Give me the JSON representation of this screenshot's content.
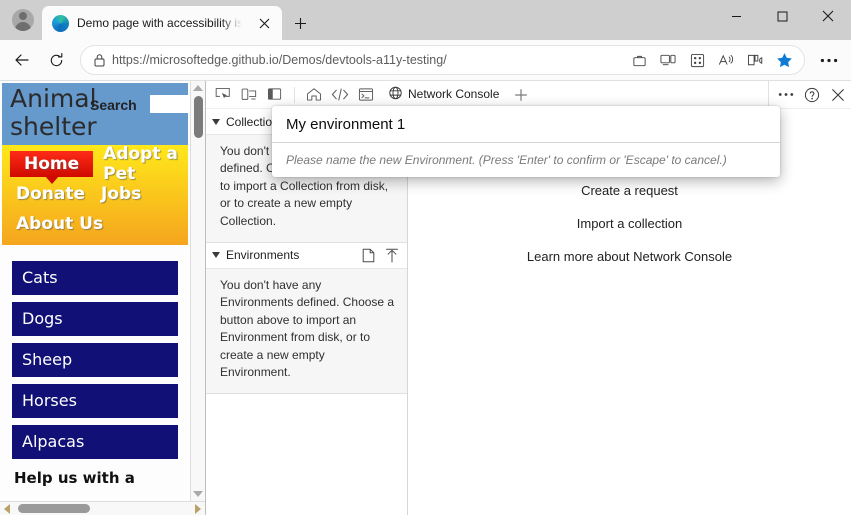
{
  "browser": {
    "tab": {
      "title": "Demo page with accessibility issues",
      "favicon": "edge-logo"
    },
    "new_tab_label": "+",
    "window_controls": {
      "minimize": "—",
      "maximize": "☐",
      "close": "✕"
    },
    "address": {
      "scheme_host": "https://microsoftedge.github.io",
      "path": "/Demos/devtools-a11y-testing/",
      "full_url": "https://microsoftedge.github.io/Demos/devtools-a11y-testing/",
      "lock_icon": "lock-icon"
    },
    "toolbar_icons": [
      "collections-icon",
      "split-screen-icon",
      "browser-essentials-icon",
      "read-aloud-icon",
      "immersive-reader-icon",
      "favorite-star-icon",
      "settings-more-icon"
    ],
    "nav_icons": {
      "back": "back-arrow-icon",
      "refresh": "refresh-icon"
    }
  },
  "webpage": {
    "site_title": "Animal shelter",
    "search_label": "Search",
    "search_value": "",
    "nav": [
      {
        "label": "Home",
        "active": true
      },
      {
        "label": "Adopt a Pet",
        "active": false
      },
      {
        "label": "Donate",
        "active": false
      },
      {
        "label": "Jobs",
        "active": false
      },
      {
        "label": "About Us",
        "active": false
      }
    ],
    "animal_buttons": [
      "Cats",
      "Dogs",
      "Sheep",
      "Horses",
      "Alpacas"
    ],
    "help_heading": "Help us with a",
    "colors": {
      "header_blue": "#6699cc",
      "nav_gradient_top": "#ffe81a",
      "nav_gradient_bottom": "#f5a51e",
      "active_red": "#cf0a00",
      "button_navy": "#101076"
    }
  },
  "devtools": {
    "toolbar": {
      "inspect_icon": "inspect-element-icon",
      "device_icon": "device-emulation-icon",
      "dock_icon": "dock-side-icon",
      "home_icon": "welcome-home-icon",
      "elements_icon": "elements-code-icon",
      "console_icon": "console-terminal-icon",
      "active_tab": {
        "label": "Network Console",
        "icon": "globe-icon"
      },
      "add_tab_label": "+",
      "more_tools_icon": "more-tools-icon",
      "help_icon": "help-question-icon",
      "close_icon": "close-devtools-icon"
    },
    "panels": [
      {
        "title": "Collections",
        "body": "You don't have any Collections defined. Choose a button above to import a Collection from disk, or to create a new empty Collection.",
        "actions": [
          "new-file-icon",
          "import-upload-icon"
        ]
      },
      {
        "title": "Environments",
        "body": "You don't have any Environments defined. Choose a button above to import an Environment from disk, or to create a new empty Environment.",
        "actions": [
          "new-file-icon",
          "import-upload-icon"
        ]
      }
    ],
    "main_links": [
      "Create a request",
      "Import a collection",
      "Learn more about Network Console"
    ],
    "prompt": {
      "value": "My environment 1",
      "hint": "Please name the new Environment. (Press 'Enter' to confirm or 'Escape' to cancel.)"
    },
    "accent_color": "#0f6cbd"
  }
}
